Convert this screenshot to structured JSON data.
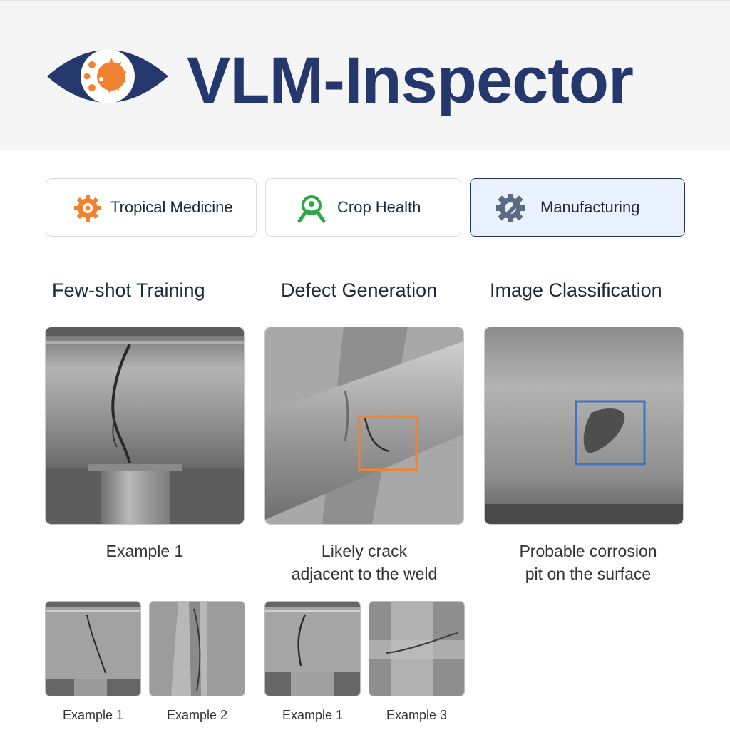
{
  "app": {
    "title": "VLM-Inspector",
    "logo_icon": "eye-logo-icon",
    "brand_color": "#24386d",
    "accent_color": "#f08332"
  },
  "tabs": [
    {
      "label": "Tropical Medicine",
      "icon": "orange-gear-bug-icon",
      "active": false
    },
    {
      "label": "Crop Health",
      "icon": "green-magnifier-icon",
      "active": false
    },
    {
      "label": "Manufacturing",
      "icon": "gear-wrench-icon",
      "active": true
    }
  ],
  "sections": [
    {
      "title": "Few-shot Training",
      "caption": "Example 1"
    },
    {
      "title": "Defect Generation",
      "caption_line1": "Likely crack",
      "caption_line2": "adjacent to the weld",
      "box_color": "#f08332"
    },
    {
      "title": "Image Classification",
      "caption_line1": "Probable corrosion",
      "caption_line2": "pit on the surface",
      "box_color": "#3b73c4"
    }
  ],
  "thumbnails": [
    {
      "label": "Example 1"
    },
    {
      "label": "Example 2"
    },
    {
      "label": "Example 1"
    },
    {
      "label": "Example 3"
    }
  ]
}
